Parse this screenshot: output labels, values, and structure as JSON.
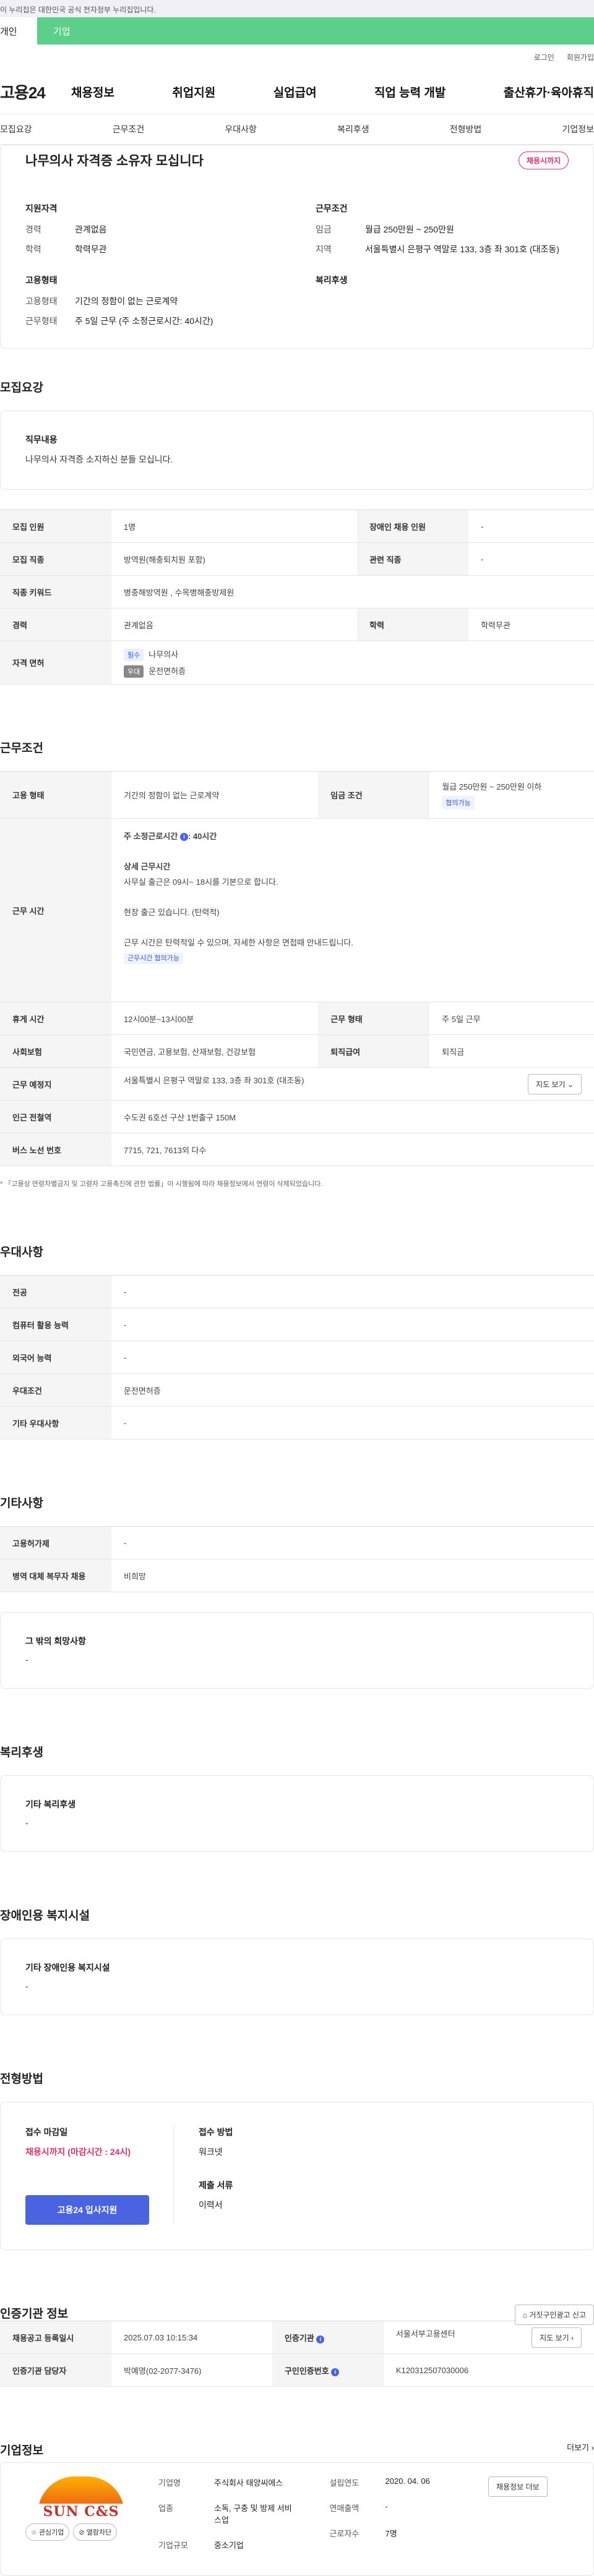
{
  "gov_banner": "이 누리집은 대한민국 공식 전자정부 누리집입니다.",
  "role_tabs": [
    "개인",
    "기업"
  ],
  "util_links": [
    "로그인",
    "회원가입"
  ],
  "logo": "고용24",
  "gnb": [
    "채용정보",
    "취업지원",
    "실업급여",
    "직업 능력 개발",
    "출산휴가·육아휴직"
  ],
  "sub_tabs": [
    "모집요강",
    "근무조건",
    "우대사항",
    "복리후생",
    "전형방법",
    "기업정보"
  ],
  "summary": {
    "title": "나무의사 자격증 소유자 모십니다",
    "badge": "채용시까지",
    "support_title": "지원자격",
    "condition_title": "근무조건",
    "employ_title": "고용형태",
    "welfare_title": "복리후생",
    "rows_support": [
      {
        "k": "경력",
        "v": "관계없음"
      },
      {
        "k": "학력",
        "v": "학력무관"
      }
    ],
    "rows_condition": [
      {
        "k": "임금",
        "v": "월급 250만원 ~ 250만원"
      },
      {
        "k": "지역",
        "v": "서울특별시 은평구 역말로 133, 3층 좌 301호 (대조동)"
      }
    ],
    "rows_employ": [
      {
        "k": "고용형태",
        "v": "기간의 정함이 없는 근로계약"
      },
      {
        "k": "근무형태",
        "v": "주 5일 근무 (주 소정근로시간: 40시간)"
      }
    ]
  },
  "recruit": {
    "section": "모집요강",
    "duty_title": "직무내용",
    "duty_text": "나무의사 자격증 소지하신 분들 모십니다.",
    "rows": [
      {
        "k1": "모집 인원",
        "v1": "1명",
        "k2": "장애인 채용 인원",
        "v2": "-"
      },
      {
        "k1": "모집 직종",
        "v1": "방역원(해충퇴치원 포함)",
        "k2": "관련 직종",
        "v2": "-"
      },
      {
        "k1": "직종 키워드",
        "v1": "병충해방역원 , 수목병해충방제원"
      },
      {
        "k1": "경력",
        "v1": "관계없음",
        "k2": "학력",
        "v2": "학력무관"
      }
    ],
    "license_label": "자격 면허",
    "license_required_chip": "필수",
    "license_required": "나무의사",
    "license_pref_chip": "우대",
    "license_pref": "운전면허증"
  },
  "work": {
    "section": "근무조건",
    "employ_type_label": "고용 형태",
    "employ_type": "기간의 정함이 없는 근로계약",
    "wage_label": "임금 조건",
    "wage": "월급 250만원 ~ 250만원 이하",
    "wage_chip": "협의가능",
    "time_label": "근무 시간",
    "time_hours": "주 소정근로시간 ",
    "time_hours_value": ": 40시간",
    "time_detail_title": "상세 근무시간",
    "time_detail_1": "사무실 출근은 09시~ 18시를 기본으로 합니다.",
    "time_detail_2": "현장 출근 있습니다. (탄력적)",
    "time_detail_3": "근무 시간은 탄력적일 수 있으며, 자세한 사항은 면접때 안내드립니다.",
    "time_chip": "근무시간 협의가능",
    "rows": [
      {
        "k1": "휴게 시간",
        "v1": "12시00분~13시00분",
        "k2": "근무 형태",
        "v2": "주 5일 근무"
      },
      {
        "k1": "사회보험",
        "v1": "국민연금, 고용보험, 산재보험, 건강보험",
        "k2": "퇴직급여",
        "v2": "퇴직금"
      }
    ],
    "location_label": "근무 예정지",
    "location": "서울특별시 은평구 역말로 133, 3층 좌 301호 (대조동)",
    "map_button": "지도 보기",
    "subway_label": "인근 전철역",
    "subway": "수도권 6호선 구산 1번출구 150M",
    "bus_label": "버스 노선 번호",
    "bus": "7715, 721, 7613외 다수",
    "note": "* 「고용상 연령차별금지 및 고령자 고용촉진에 관한 법률」이 시행됨에 따라 채용정보에서 연령이 삭제되었습니다."
  },
  "preference": {
    "section": "우대사항",
    "rows": [
      {
        "k": "전공",
        "v": "-"
      },
      {
        "k": "컴퓨터 활용 능력",
        "v": "-"
      },
      {
        "k": "외국어 능력",
        "v": "-"
      },
      {
        "k": "우대조건",
        "v": "운전면허증"
      },
      {
        "k": "기타 우대사항",
        "v": "-"
      }
    ]
  },
  "etc": {
    "section": "기타사항",
    "rows": [
      {
        "k": "고용허가제",
        "v": "-"
      },
      {
        "k": "병역 대체 복무자 채용",
        "v": "비희망"
      }
    ],
    "other_title": "그 밖의 희망사항",
    "other_text": "-"
  },
  "welfare": {
    "section": "복리후생",
    "title": "기타 복리후생",
    "text": "-"
  },
  "disability": {
    "section": "장애인용 복지시설",
    "title": "기타 장애인용 복지시설",
    "text": "-"
  },
  "hiring": {
    "section": "전형방법",
    "deadline_label": "접수 마감일",
    "deadline": "채용시까지 (마감시간 : 24시)",
    "method_label": "접수 방법",
    "method": "워크넷",
    "docs_label": "제출 서류",
    "docs": "이력서",
    "apply_button": "고용24 입사지원"
  },
  "agency": {
    "section": "인증기관 정보",
    "report_button": "거짓구인광고 신고",
    "rows": [
      {
        "k1": "채용공고 등록일시",
        "v1": "2025.07.03 10:15:34",
        "k2": "인증기관",
        "v2": "서울서부고용센터",
        "btn": "지도 보기"
      },
      {
        "k1": "인증기관 담당자",
        "v1": "박예영(02-2077-3476)",
        "k2": "구인인증번호",
        "v2": "K120312507030006"
      }
    ]
  },
  "company": {
    "section": "기업정보",
    "more": "더보기",
    "logo_text": "SUN C&S",
    "fav_button": "관심기업",
    "block_button": "열람차단",
    "info_button": "채용정보 더보",
    "rows_left": [
      {
        "k": "기업명",
        "v": "주식회사 태양씨에스"
      },
      {
        "k": "업종",
        "v": "소독, 구충 및 방제 서비스업"
      },
      {
        "k": "기업규모",
        "v": "중소기업"
      }
    ],
    "rows_right": [
      {
        "k": "설립연도",
        "v": "2020. 04. 06"
      },
      {
        "k": "연매출액",
        "v": "-"
      },
      {
        "k": "근로자수",
        "v": "7명"
      }
    ]
  },
  "colors": {
    "accent": "#4a63e0",
    "brand_green": "#5cd08a",
    "danger": "#e2326a"
  }
}
